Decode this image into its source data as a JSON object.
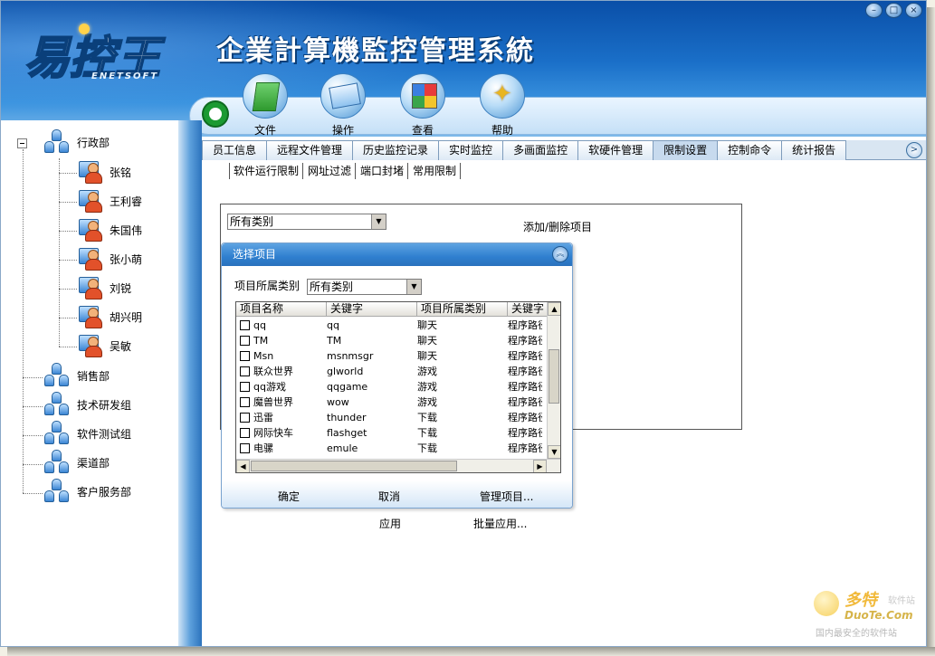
{
  "app": {
    "logo_text": "易控王",
    "logo_sub": "ENETSOFT",
    "title": "企業計算機監控管理系統"
  },
  "window_controls": [
    "–",
    "□",
    "×"
  ],
  "toolbar": [
    {
      "label": "文件",
      "icon": "folder-icon"
    },
    {
      "label": "操作",
      "icon": "operation-icon"
    },
    {
      "label": "查看",
      "icon": "view-icon"
    },
    {
      "label": "帮助",
      "icon": "help-icon"
    }
  ],
  "tree": {
    "root": "行政部",
    "members": [
      "张铭",
      "王利睿",
      "朱国伟",
      "张小萌",
      "刘锐",
      "胡兴明",
      "吴敏"
    ],
    "groups": [
      "销售部",
      "技术研发组",
      "软件测试组",
      "渠道部",
      "客户服务部"
    ]
  },
  "tabs": [
    "员工信息",
    "远程文件管理",
    "历史监控记录",
    "实时监控",
    "多画面监控",
    "软硬件管理",
    "限制设置",
    "控制命令",
    "统计报告"
  ],
  "active_tab": "限制设置",
  "subtabs": [
    "软件运行限制",
    "网址过滤",
    "端口封堵",
    "常用限制"
  ],
  "panel": {
    "category_value": "所有类别",
    "add_remove_label": "添加/删除项目",
    "apply_label": "应用",
    "batch_apply_label": "批量应用..."
  },
  "dialog": {
    "title": "选择项目",
    "category_label": "项目所属类别",
    "category_value": "所有类别",
    "columns": [
      "项目名称",
      "关键字",
      "项目所属类别",
      "关键字"
    ],
    "rows": [
      {
        "name": "qq",
        "keyword": "qq",
        "category": "聊天",
        "type": "程序路径"
      },
      {
        "name": "TM",
        "keyword": "TM",
        "category": "聊天",
        "type": "程序路径"
      },
      {
        "name": "Msn",
        "keyword": "msnmsgr",
        "category": "聊天",
        "type": "程序路径"
      },
      {
        "name": "联众世界",
        "keyword": "glworld",
        "category": "游戏",
        "type": "程序路径"
      },
      {
        "name": "qq游戏",
        "keyword": "qqgame",
        "category": "游戏",
        "type": "程序路径"
      },
      {
        "name": "魔兽世界",
        "keyword": "wow",
        "category": "游戏",
        "type": "程序路径"
      },
      {
        "name": "迅雷",
        "keyword": "thunder",
        "category": "下载",
        "type": "程序路径"
      },
      {
        "name": "网际快车",
        "keyword": "flashget",
        "category": "下载",
        "type": "程序路径"
      },
      {
        "name": "电骡",
        "keyword": "emule",
        "category": "下载",
        "type": "程序路径"
      }
    ],
    "ok_label": "确定",
    "cancel_label": "取消",
    "manage_label": "管理项目..."
  },
  "watermark": {
    "brand": "多特",
    "brand_sub": "软件站",
    "site": "DuoTe.Com",
    "tagline": "国内最安全的软件站"
  },
  "colors": {
    "header_blue": "#1a6fc8",
    "dialog_title_blue": "#2f7fcf",
    "tab_bg": "#d9e6f2"
  }
}
